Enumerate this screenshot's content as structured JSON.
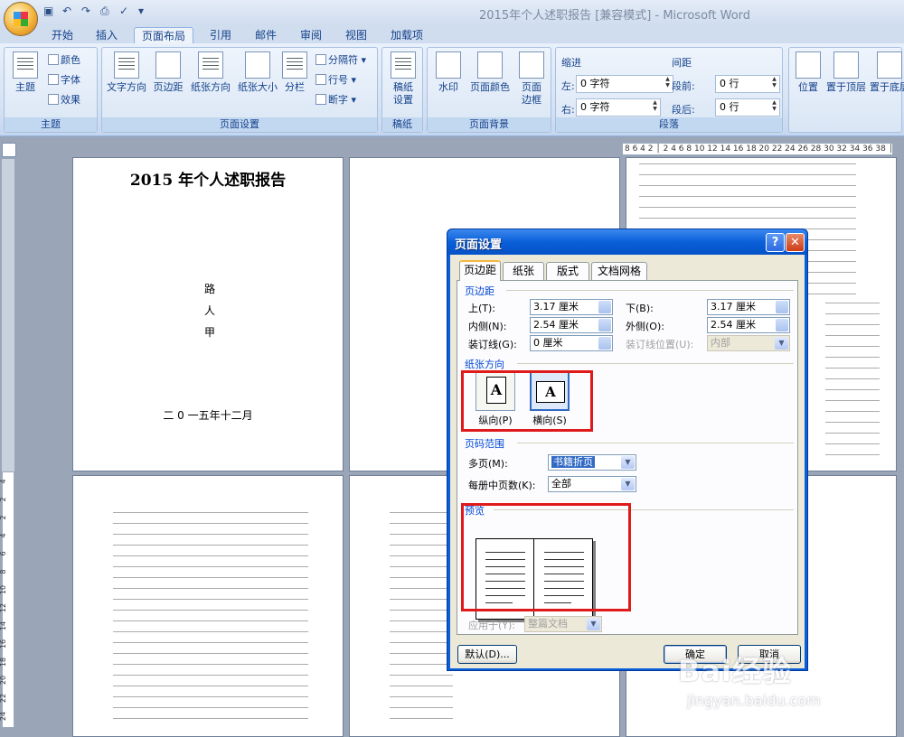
{
  "window": {
    "title": "2015年个人述职报告 [兼容模式] - Microsoft Word"
  },
  "ribbon_tabs": [
    "开始",
    "插入",
    "页面布局",
    "引用",
    "邮件",
    "审阅",
    "视图",
    "加载项"
  ],
  "active_tab": "页面布局",
  "ribbon": {
    "theme": {
      "main": "主题",
      "colors": "颜色",
      "fonts": "字体",
      "effects": "效果",
      "group": "主题"
    },
    "page_setup": {
      "text_direction": "文字方向",
      "margins": "页边距",
      "orientation": "纸张方向",
      "size": "纸张大小",
      "columns": "分栏",
      "breaks": "分隔符",
      "line_numbers": "行号",
      "hyphenation": "断字",
      "group": "页面设置"
    },
    "draft": {
      "btn": "稿纸\n设置",
      "group": "稿纸"
    },
    "background": {
      "watermark": "水印",
      "page_color": "页面颜色",
      "page_borders": "页面\n边框",
      "group": "页面背景"
    },
    "paragraph": {
      "indent": "缩进",
      "spacing": "间距",
      "left": "左:",
      "right": "右:",
      "before": "段前:",
      "after": "段后:",
      "left_val": "0 字符",
      "right_val": "0 字符",
      "before_val": "0 行",
      "after_val": "0 行",
      "group": "段落"
    },
    "arrange": {
      "position": "位置",
      "front": "置于顶层",
      "back": "置于底层"
    }
  },
  "ruler": {
    "horizontal": "8 6 4 2 │ 2 4 6 8 10 12 14 16 18 20 22 24 26 28 30 32 34 36 38 │ 42 44 46",
    "vertical": [
      "4",
      "2",
      "2",
      "4",
      "6",
      "8",
      "10",
      "12",
      "14",
      "16",
      "18",
      "20",
      "22",
      "24",
      "26",
      "28",
      "30"
    ]
  },
  "document": {
    "title": "2015 年个人述职报告",
    "author_chars": [
      "路",
      "人",
      "甲"
    ],
    "date": "二 0 一五年十二月"
  },
  "dialog": {
    "title": "页面设置",
    "help": "?",
    "close": "✕",
    "tabs": [
      "页边距",
      "纸张",
      "版式",
      "文档网格"
    ],
    "margins_section": "页边距",
    "top_label": "上(T):",
    "top_value": "3.17 厘米",
    "bottom_label": "下(B):",
    "bottom_value": "3.17 厘米",
    "inside_label": "内侧(N):",
    "inside_value": "2.54 厘米",
    "outside_label": "外侧(O):",
    "outside_value": "2.54 厘米",
    "gutter_label": "装订线(G):",
    "gutter_value": "0 厘米",
    "gutter_pos_label": "装订线位置(U):",
    "gutter_pos_value": "内部",
    "orientation_section": "纸张方向",
    "portrait": "纵向(P)",
    "landscape": "横向(S)",
    "pages_section": "页码范围",
    "multiple_label": "多页(M):",
    "multiple_value": "书籍折页",
    "sheets_label": "每册中页数(K):",
    "sheets_value": "全部",
    "preview_section": "预览",
    "apply_label": "应用于(Y):",
    "apply_value": "整篇文档",
    "default_btn": "默认(D)...",
    "ok_btn": "确定",
    "cancel_btn": "取消"
  },
  "watermark": {
    "brand": "Bai经验",
    "url": "jingyan.baidu.com"
  }
}
